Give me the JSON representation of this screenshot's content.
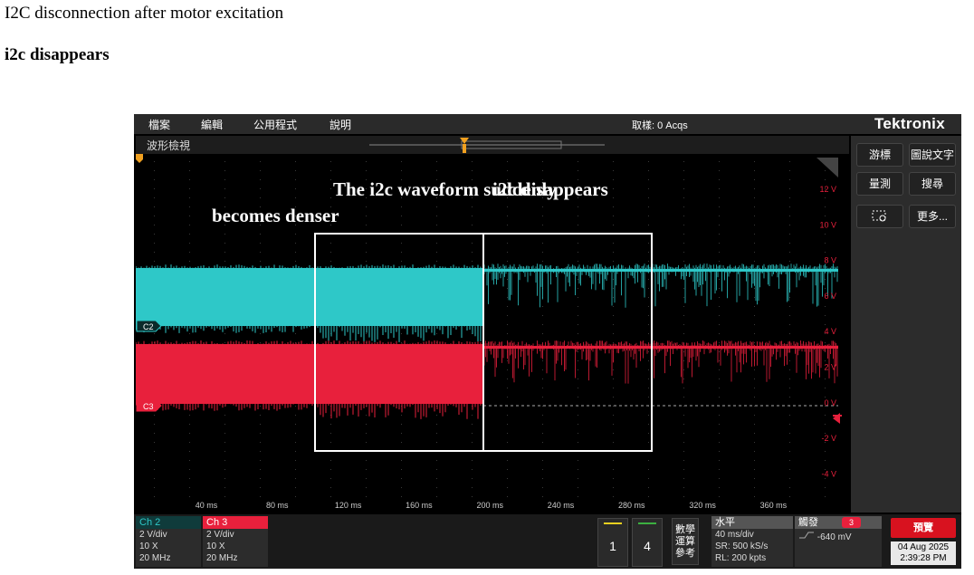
{
  "doc": {
    "title": "I2C disconnection after motor excitation",
    "subtitle": "i2c disappears"
  },
  "menu": [
    "檔案",
    "編輯",
    "公用程式",
    "說明"
  ],
  "acq_status": "取樣: 0 Acqs",
  "brand": "Tektronix",
  "waveform_view": {
    "title": "波形檢視",
    "annotation_left": [
      "The i2c waveform suddenly",
      "becomes denser"
    ],
    "annotation_right": "i2c disappears",
    "y_labels": [
      "12 V",
      "10 V",
      "8 V",
      "6 V",
      "4 V",
      "2 V",
      "0 V",
      "-2 V",
      "-4 V"
    ],
    "x_labels": [
      "40 ms",
      "80 ms",
      "120 ms",
      "160 ms",
      "200 ms",
      "240 ms",
      "280 ms",
      "320 ms",
      "360 ms"
    ],
    "ch2_marker": "C2",
    "ch3_marker": "C3",
    "colors": {
      "ch2": "#2ec8c8",
      "ch3": "#e8203c",
      "box": "#ffffff"
    }
  },
  "side_buttons": [
    "游標",
    "圖說文字",
    "量測",
    "搜尋",
    "",
    "更多..."
  ],
  "channels": [
    {
      "name": "Ch 2",
      "scale": "2 V/div",
      "probe": "10 X",
      "bw": "20 MHz",
      "color": "#2ec8c8"
    },
    {
      "name": "Ch 3",
      "scale": "2 V/div",
      "probe": "10 X",
      "bw": "20 MHz",
      "color": "#e8203c"
    }
  ],
  "num_buttons": [
    "1",
    "4"
  ],
  "math_button": [
    "數學",
    "運算",
    "參考"
  ],
  "horizontal": {
    "title": "水平",
    "lines": [
      "40 ms/div",
      "SR: 500 kS/s",
      "RL: 200 kpts"
    ]
  },
  "trigger": {
    "title": "觸發",
    "source": "3",
    "level": "-640 mV"
  },
  "run_button": "預覽",
  "datetime": {
    "date": "04 Aug 2025",
    "time": "2:39:28 PM"
  }
}
